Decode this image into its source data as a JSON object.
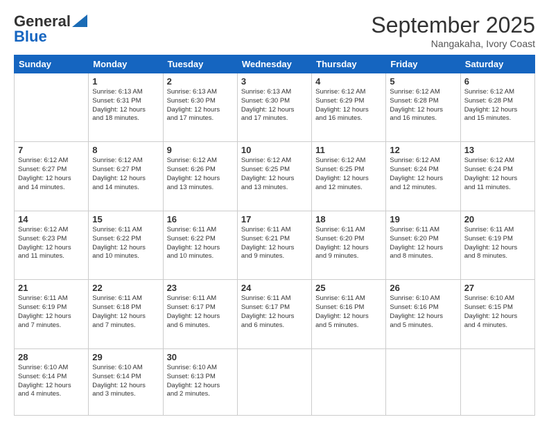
{
  "logo": {
    "line1": "General",
    "line2": "Blue"
  },
  "header": {
    "month": "September 2025",
    "location": "Nangakaha, Ivory Coast"
  },
  "days_of_week": [
    "Sunday",
    "Monday",
    "Tuesday",
    "Wednesday",
    "Thursday",
    "Friday",
    "Saturday"
  ],
  "weeks": [
    [
      {
        "day": "",
        "info": ""
      },
      {
        "day": "1",
        "info": "Sunrise: 6:13 AM\nSunset: 6:31 PM\nDaylight: 12 hours\nand 18 minutes."
      },
      {
        "day": "2",
        "info": "Sunrise: 6:13 AM\nSunset: 6:30 PM\nDaylight: 12 hours\nand 17 minutes."
      },
      {
        "day": "3",
        "info": "Sunrise: 6:13 AM\nSunset: 6:30 PM\nDaylight: 12 hours\nand 17 minutes."
      },
      {
        "day": "4",
        "info": "Sunrise: 6:12 AM\nSunset: 6:29 PM\nDaylight: 12 hours\nand 16 minutes."
      },
      {
        "day": "5",
        "info": "Sunrise: 6:12 AM\nSunset: 6:28 PM\nDaylight: 12 hours\nand 16 minutes."
      },
      {
        "day": "6",
        "info": "Sunrise: 6:12 AM\nSunset: 6:28 PM\nDaylight: 12 hours\nand 15 minutes."
      }
    ],
    [
      {
        "day": "7",
        "info": "Sunrise: 6:12 AM\nSunset: 6:27 PM\nDaylight: 12 hours\nand 14 minutes."
      },
      {
        "day": "8",
        "info": "Sunrise: 6:12 AM\nSunset: 6:27 PM\nDaylight: 12 hours\nand 14 minutes."
      },
      {
        "day": "9",
        "info": "Sunrise: 6:12 AM\nSunset: 6:26 PM\nDaylight: 12 hours\nand 13 minutes."
      },
      {
        "day": "10",
        "info": "Sunrise: 6:12 AM\nSunset: 6:25 PM\nDaylight: 12 hours\nand 13 minutes."
      },
      {
        "day": "11",
        "info": "Sunrise: 6:12 AM\nSunset: 6:25 PM\nDaylight: 12 hours\nand 12 minutes."
      },
      {
        "day": "12",
        "info": "Sunrise: 6:12 AM\nSunset: 6:24 PM\nDaylight: 12 hours\nand 12 minutes."
      },
      {
        "day": "13",
        "info": "Sunrise: 6:12 AM\nSunset: 6:24 PM\nDaylight: 12 hours\nand 11 minutes."
      }
    ],
    [
      {
        "day": "14",
        "info": "Sunrise: 6:12 AM\nSunset: 6:23 PM\nDaylight: 12 hours\nand 11 minutes."
      },
      {
        "day": "15",
        "info": "Sunrise: 6:11 AM\nSunset: 6:22 PM\nDaylight: 12 hours\nand 10 minutes."
      },
      {
        "day": "16",
        "info": "Sunrise: 6:11 AM\nSunset: 6:22 PM\nDaylight: 12 hours\nand 10 minutes."
      },
      {
        "day": "17",
        "info": "Sunrise: 6:11 AM\nSunset: 6:21 PM\nDaylight: 12 hours\nand 9 minutes."
      },
      {
        "day": "18",
        "info": "Sunrise: 6:11 AM\nSunset: 6:20 PM\nDaylight: 12 hours\nand 9 minutes."
      },
      {
        "day": "19",
        "info": "Sunrise: 6:11 AM\nSunset: 6:20 PM\nDaylight: 12 hours\nand 8 minutes."
      },
      {
        "day": "20",
        "info": "Sunrise: 6:11 AM\nSunset: 6:19 PM\nDaylight: 12 hours\nand 8 minutes."
      }
    ],
    [
      {
        "day": "21",
        "info": "Sunrise: 6:11 AM\nSunset: 6:19 PM\nDaylight: 12 hours\nand 7 minutes."
      },
      {
        "day": "22",
        "info": "Sunrise: 6:11 AM\nSunset: 6:18 PM\nDaylight: 12 hours\nand 7 minutes."
      },
      {
        "day": "23",
        "info": "Sunrise: 6:11 AM\nSunset: 6:17 PM\nDaylight: 12 hours\nand 6 minutes."
      },
      {
        "day": "24",
        "info": "Sunrise: 6:11 AM\nSunset: 6:17 PM\nDaylight: 12 hours\nand 6 minutes."
      },
      {
        "day": "25",
        "info": "Sunrise: 6:11 AM\nSunset: 6:16 PM\nDaylight: 12 hours\nand 5 minutes."
      },
      {
        "day": "26",
        "info": "Sunrise: 6:10 AM\nSunset: 6:16 PM\nDaylight: 12 hours\nand 5 minutes."
      },
      {
        "day": "27",
        "info": "Sunrise: 6:10 AM\nSunset: 6:15 PM\nDaylight: 12 hours\nand 4 minutes."
      }
    ],
    [
      {
        "day": "28",
        "info": "Sunrise: 6:10 AM\nSunset: 6:14 PM\nDaylight: 12 hours\nand 4 minutes."
      },
      {
        "day": "29",
        "info": "Sunrise: 6:10 AM\nSunset: 6:14 PM\nDaylight: 12 hours\nand 3 minutes."
      },
      {
        "day": "30",
        "info": "Sunrise: 6:10 AM\nSunset: 6:13 PM\nDaylight: 12 hours\nand 2 minutes."
      },
      {
        "day": "",
        "info": ""
      },
      {
        "day": "",
        "info": ""
      },
      {
        "day": "",
        "info": ""
      },
      {
        "day": "",
        "info": ""
      }
    ]
  ]
}
